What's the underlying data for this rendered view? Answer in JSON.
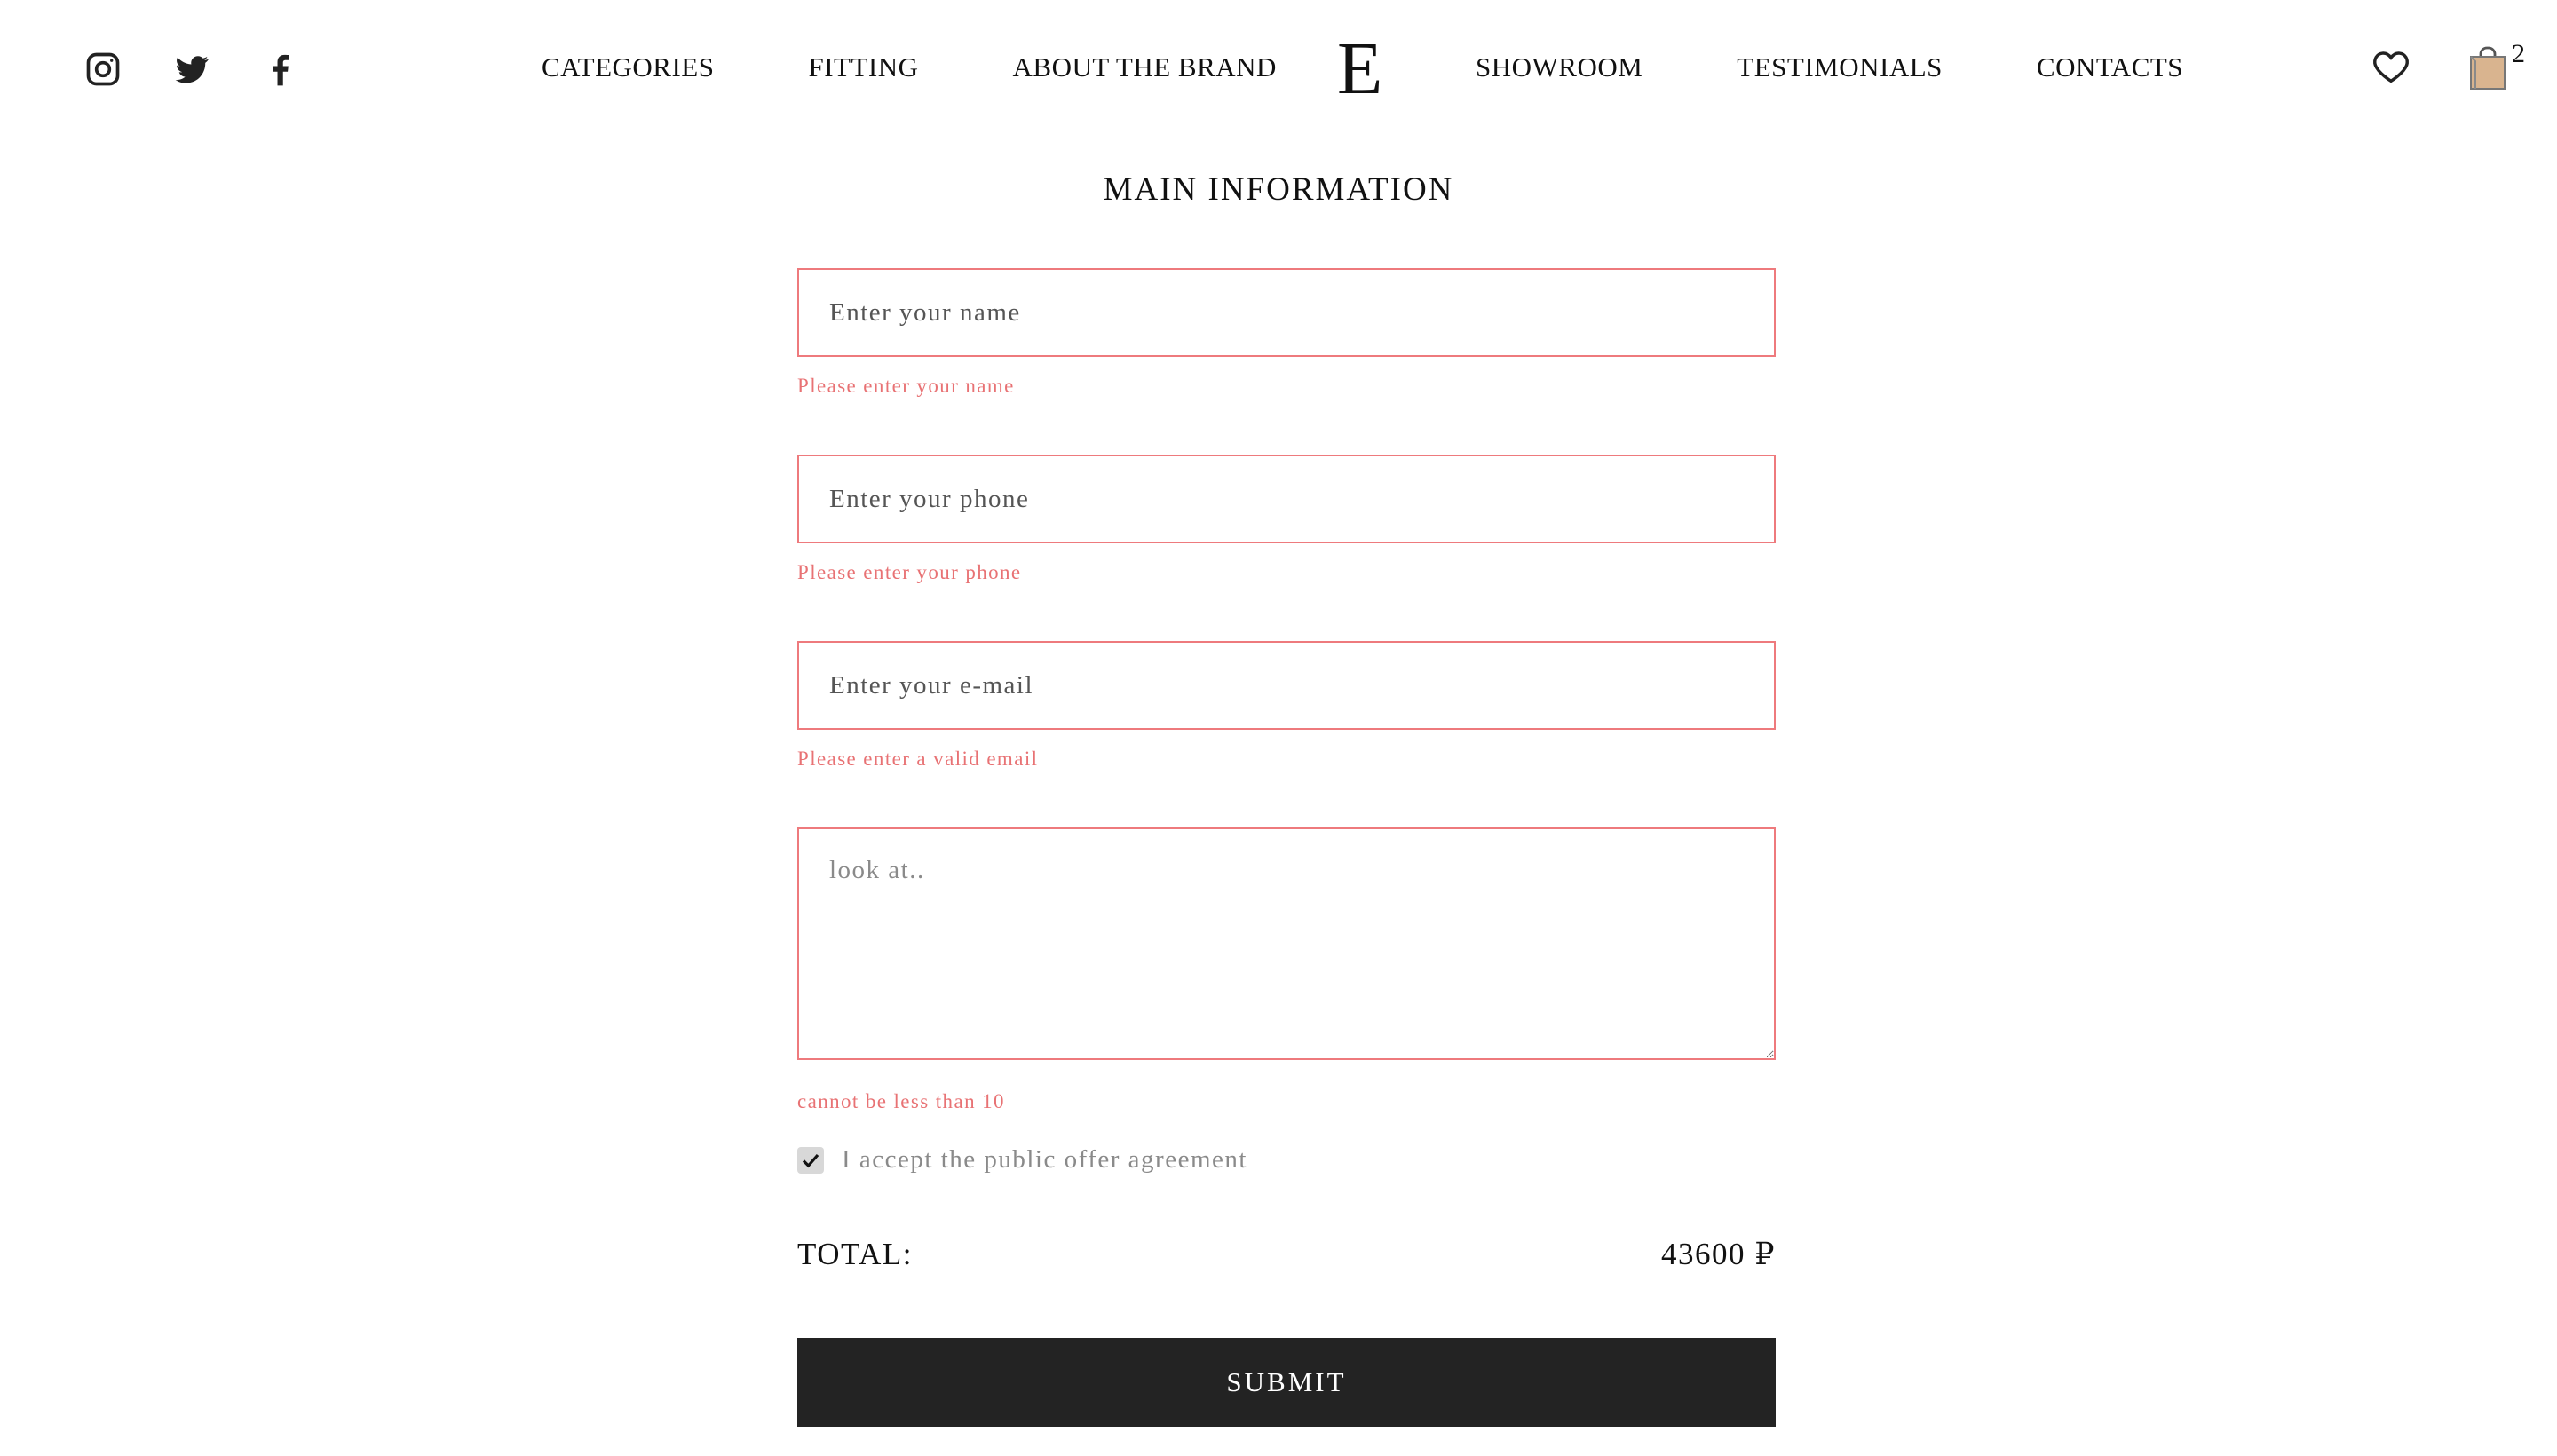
{
  "header": {
    "social": [
      {
        "icon": "instagram-icon"
      },
      {
        "icon": "twitter-icon"
      },
      {
        "icon": "facebook-icon"
      }
    ],
    "nav_left": [
      "CATEGORIES",
      "FITTING",
      "ABOUT THE BRAND"
    ],
    "logo": "E",
    "nav_right": [
      "SHOWROOM",
      "TESTIMONIALS",
      "CONTACTS"
    ],
    "cart_count": "2",
    "icons": {
      "wishlist": "heart-icon",
      "cart": "shopping-bag-icon"
    }
  },
  "form": {
    "title": "MAIN INFORMATION",
    "name": {
      "placeholder": "Enter your name",
      "value": "",
      "error": "Please enter your name"
    },
    "phone": {
      "placeholder": "Enter your phone",
      "value": "",
      "error": "Please enter your phone"
    },
    "email": {
      "placeholder": "Enter your e-mail",
      "value": "",
      "error": "Please enter a valid email"
    },
    "comment": {
      "value": "look at..",
      "error": "cannot be less than 10"
    },
    "agreement": {
      "label": "I accept the public offer agreement",
      "checked": true
    },
    "total_label": "TOTAL:",
    "total_value": "43600 ₽",
    "submit_label": "SUBMIT"
  },
  "colors": {
    "error": "#e87274",
    "border_error": "#ee7a7d",
    "button_bg": "#232323",
    "cart_bag": "#d9b48f"
  }
}
